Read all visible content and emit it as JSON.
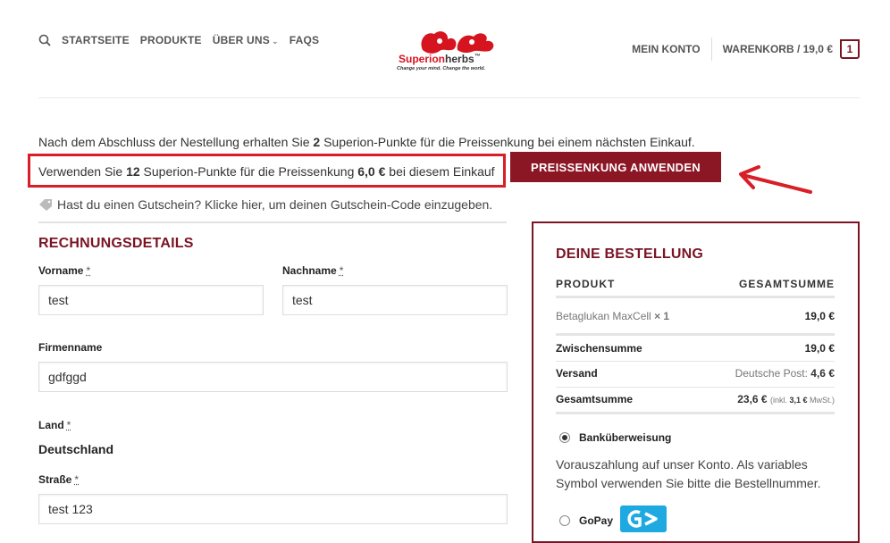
{
  "header": {
    "nav": [
      "STARTSEITE",
      "PRODUKTE",
      "ÜBER UNS",
      "FAQS"
    ],
    "logo": {
      "brand_red": "Superion",
      "brand_dark": "herbs",
      "tm": "™",
      "tagline": "Change your mind. Change the world."
    },
    "account": "MEIN KONTO",
    "cart": "WARENKORB / 19,0 €",
    "cart_count": "1"
  },
  "notices": {
    "points_info": {
      "pre": "Nach dem Abschluss der Nestellung erhalten Sie ",
      "points": "2",
      "post": " Superion-Punkte für die Preissenkung bei einem nächsten Einkauf."
    },
    "points_use": {
      "pre": "Verwenden Sie ",
      "points": "12",
      "mid": " Superion-Punkte für die Preissenkung ",
      "amount": "6,0 €",
      "post": " bei diesem Einkauf"
    },
    "apply_button": "PREISSENKUNG ANWENDEN",
    "coupon": "Hast du einen Gutschein? Klicke hier, um deinen Gutschein-Code einzugeben."
  },
  "billing": {
    "title": "RECHNUNGSDETAILS",
    "first_name": {
      "label": "Vorname",
      "required": "*",
      "value": "test"
    },
    "last_name": {
      "label": "Nachname",
      "required": "*",
      "value": "test"
    },
    "company": {
      "label": "Firmenname",
      "value": "gdfggd"
    },
    "country": {
      "label": "Land",
      "required": "*",
      "value": "Deutschland"
    },
    "street": {
      "label": "Straße",
      "required": "*",
      "value": "test 123"
    }
  },
  "order": {
    "title": "DEINE BESTELLUNG",
    "col_product": "PRODUKT",
    "col_total": "GESAMTSUMME",
    "item": {
      "name": "Betaglukan MaxCell",
      "qty": "× 1",
      "price": "19,0 €"
    },
    "subtotal": {
      "label": "Zwischensumme",
      "value": "19,0 €"
    },
    "shipping": {
      "label": "Versand",
      "method": "Deutsche Post:",
      "value": "4,6 €"
    },
    "total": {
      "label": "Gesamtsumme",
      "value": "23,6 €",
      "tax_pre": "(inkl. ",
      "tax": "3,1 €",
      "tax_post": " MwSt.)"
    },
    "payment": {
      "bank": "Banküberweisung",
      "bank_desc": "Vorauszahlung auf unser Konto. Als variables Symbol verwenden Sie bitte die Bestellnummer.",
      "gopay": "GoPay"
    }
  },
  "colors": {
    "brand": "#7a1424",
    "button": "#8b1624",
    "highlight": "#d81e26"
  }
}
